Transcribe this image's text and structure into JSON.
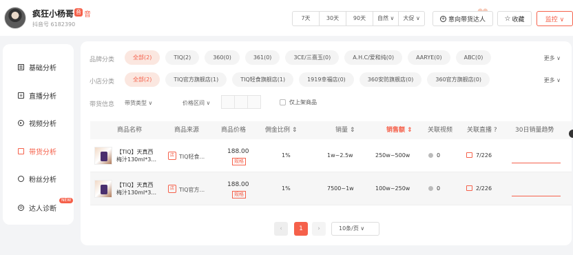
{
  "header": {
    "user_name": "疯狂小杨哥",
    "platform_badge": "音",
    "platform_text": "音",
    "user_id": "抖音号 6182390",
    "ranges": [
      "7天",
      "30天",
      "90天",
      "自然 ∨",
      "大促 ∨"
    ],
    "intent_button": "意向带货达人",
    "favorite_button": "收藏",
    "monitor_button": "监控 ∨"
  },
  "sidebar": {
    "items": [
      {
        "label": "基础分析",
        "icon": "chart-icon"
      },
      {
        "label": "直播分析",
        "icon": "live-icon"
      },
      {
        "label": "视频分析",
        "icon": "play-icon"
      },
      {
        "label": "带货分析",
        "icon": "bag-icon"
      },
      {
        "label": "粉丝分析",
        "icon": "user-icon"
      },
      {
        "label": "达人诊断",
        "icon": "diagnose-icon"
      }
    ],
    "new_tag": "NEW"
  },
  "filters": {
    "brand_label": "品牌分类",
    "brands": [
      "全部(2)",
      "TIQ(2)",
      "360(0)",
      "361(0)",
      "3CE/三熹玉(0)",
      "A.H.C/爱和纯(0)",
      "AARYE(0)",
      "ABC(0)"
    ],
    "shop_label": "小店分类",
    "shops": [
      "全部(2)",
      "TIQ官方旗舰店(1)",
      "TIQ轻食旗舰店(1)",
      "1919幸福店(0)",
      "360安防旗舰店(0)",
      "360官方旗舰店(0)"
    ],
    "more": "更多 ∨",
    "goods_label": "带货信息",
    "goods_type": "带货类型 ∨",
    "price_range": "价格区间 ∨",
    "new_only": "仅上架商品"
  },
  "table": {
    "headers": [
      "商品名称",
      "商品来源",
      "商品价格",
      "佣金比例 ⇕",
      "销量 ⇕",
      "销售额 ⇕",
      "关联视频",
      "关联直播 ?",
      "30日销量趋势"
    ],
    "rows": [
      {
        "name": "【TIQ】天真西梅汁130ml*3...",
        "shop": "TIQ轻食...",
        "price": "188.00",
        "spec": "规格",
        "commission": "1%",
        "sales": "1w~2.5w",
        "revenue": "250w~500w",
        "videos": "0",
        "lives": "7/226"
      },
      {
        "name": "【TIQ】天真西梅汁130ml*3...",
        "shop": "TIQ官方...",
        "price": "188.00",
        "spec": "规格",
        "commission": "1%",
        "sales": "7500~1w",
        "revenue": "100w~250w",
        "videos": "0",
        "lives": "2/226"
      }
    ]
  },
  "pagination": {
    "prev": "‹",
    "current": "1",
    "next": "›",
    "page_size": "10条/页 ∨"
  },
  "colors": {
    "accent": "#f5604a"
  }
}
